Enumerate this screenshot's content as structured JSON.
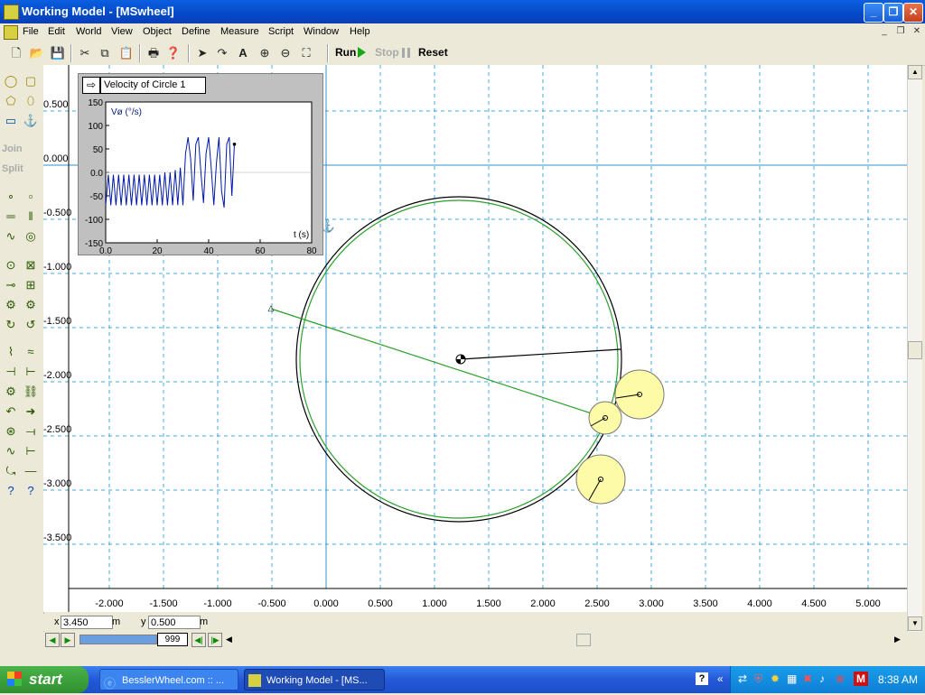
{
  "window": {
    "title": "Working Model - [MSwheel]"
  },
  "menu": [
    "File",
    "Edit",
    "World",
    "View",
    "Object",
    "Define",
    "Measure",
    "Script",
    "Window",
    "Help"
  ],
  "toolbar": {
    "run": "Run",
    "stop": "Stop",
    "reset": "Reset"
  },
  "palette": {
    "join": "Join",
    "split": "Split"
  },
  "graph": {
    "title": "Velocity of Circle 1",
    "ylabel": "Vø (°/s)",
    "xlabel": "t (s)",
    "yticks": [
      "150",
      "100",
      "50",
      "0.0",
      "-50",
      "-100",
      "-150"
    ],
    "xticks": [
      "0.0",
      "20",
      "40",
      "60",
      "80"
    ]
  },
  "axes": {
    "y_labels": [
      "0.500",
      "0.000",
      "-0.500",
      "-1.000",
      "-1.500",
      "-2.000",
      "-2.500",
      "-3.000",
      "-3.500"
    ],
    "x_labels": [
      "-2.000",
      "-1.500",
      "-1.000",
      "-0.500",
      "0.000",
      "0.500",
      "1.000",
      "1.500",
      "2.000",
      "2.500",
      "3.000",
      "3.500",
      "4.000",
      "4.500",
      "5.000"
    ]
  },
  "coords": {
    "x_label": "x",
    "x_value": "3.450",
    "x_unit": "m",
    "y_label": "y",
    "y_value": "0.500",
    "y_unit": "m"
  },
  "frame": {
    "value": "999"
  },
  "taskbar": {
    "start": "start",
    "tasks": [
      "BesslerWheel.com :: ...",
      "Working Model - [MS..."
    ],
    "clock": "8:38 AM"
  },
  "chart_data": {
    "type": "line",
    "title": "Velocity of Circle 1",
    "xlabel": "t (s)",
    "ylabel": "Vø (°/s)",
    "xlim": [
      0,
      80
    ],
    "ylim": [
      -150,
      150
    ],
    "series": [
      {
        "x": [
          0,
          1,
          2,
          3,
          4,
          5,
          6,
          7,
          8,
          9,
          10,
          11,
          12,
          13,
          14,
          15,
          16,
          17,
          18,
          19,
          20,
          21,
          22,
          23,
          24,
          25,
          26,
          27,
          28,
          29,
          30,
          31,
          32,
          33,
          34,
          35,
          36,
          37,
          38,
          39,
          40,
          41,
          42,
          43,
          44,
          45,
          46,
          47,
          48,
          49,
          50
        ],
        "y": [
          -70,
          -5,
          -70,
          -5,
          -70,
          -5,
          -70,
          -5,
          -70,
          -5,
          -70,
          -5,
          -70,
          -5,
          -70,
          -5,
          -70,
          -5,
          -70,
          -5,
          -70,
          -5,
          -70,
          0,
          -70,
          0,
          -70,
          5,
          -70,
          10,
          -70,
          40,
          75,
          30,
          -60,
          60,
          75,
          0,
          -65,
          40,
          75,
          10,
          -70,
          20,
          75,
          -40,
          -75,
          60,
          75,
          -50,
          60
        ]
      }
    ]
  }
}
